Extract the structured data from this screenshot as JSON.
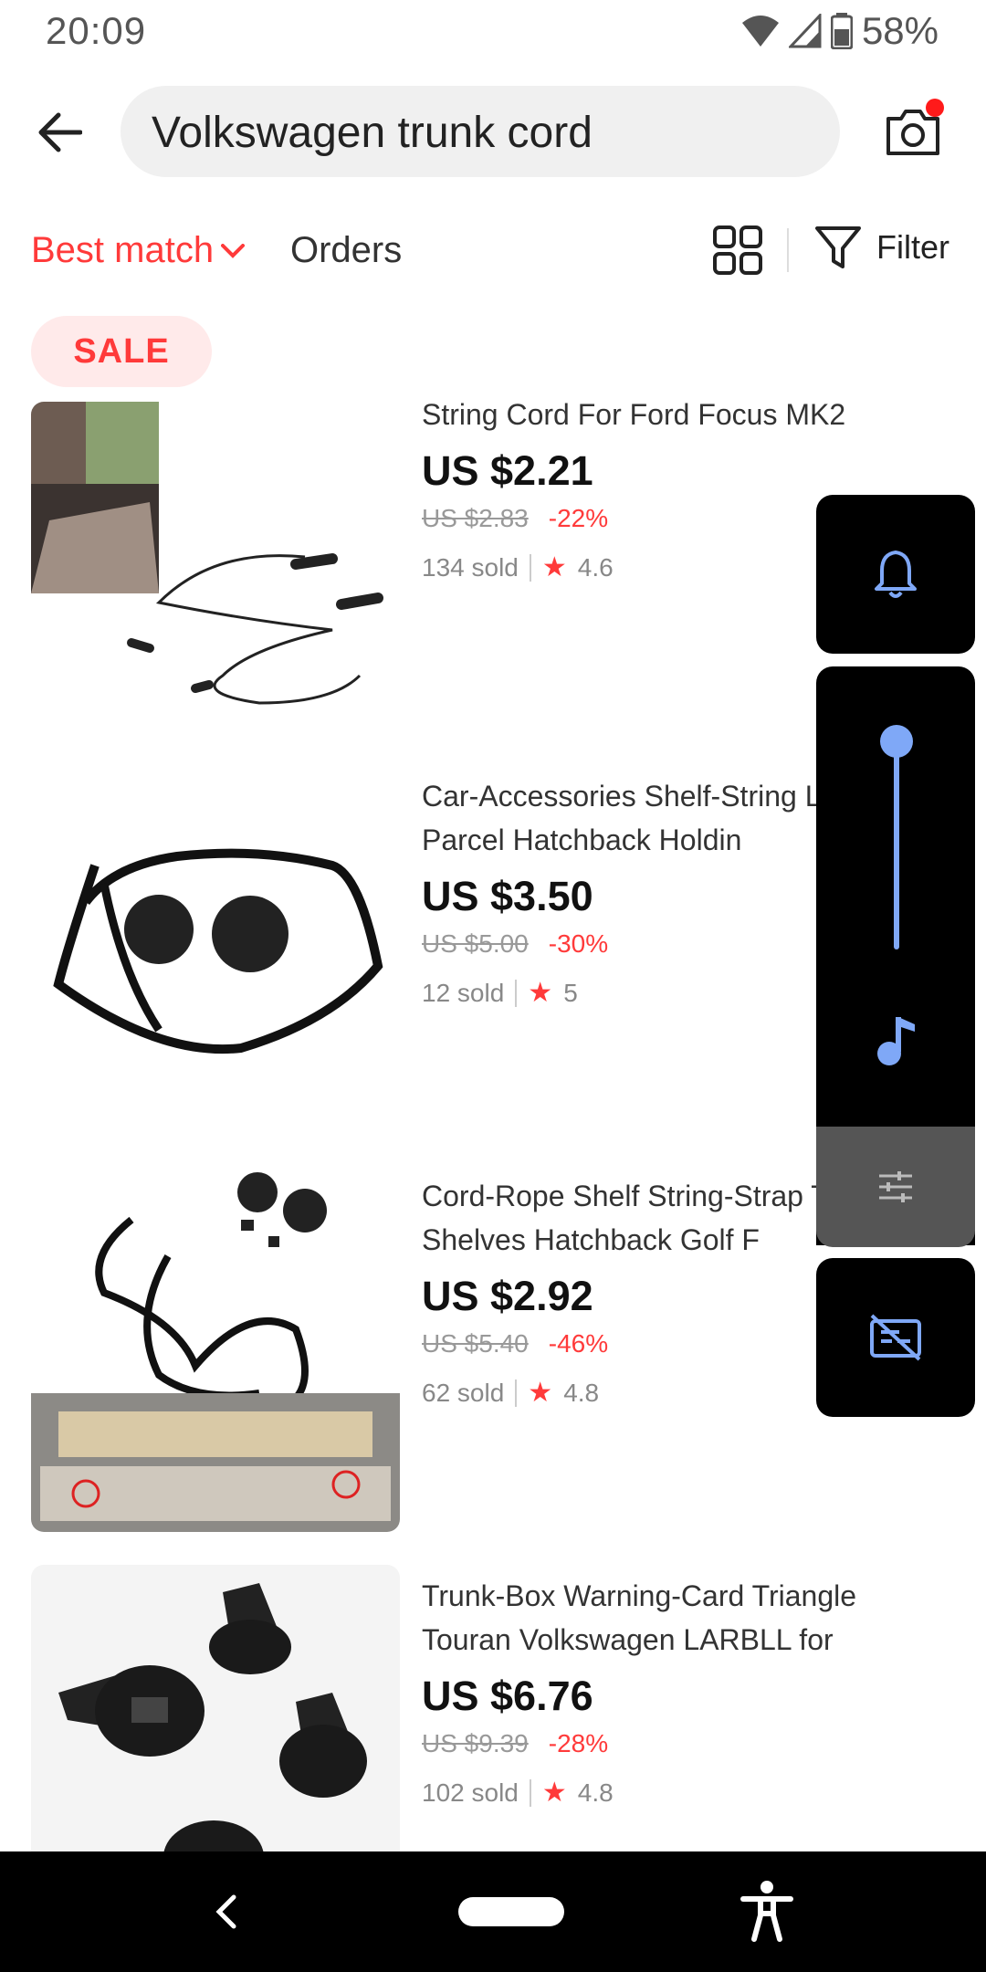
{
  "status_bar": {
    "time": "20:09",
    "battery": "58%"
  },
  "search": {
    "query": "Volkswagen trunk cord"
  },
  "sort": {
    "best_match": "Best match",
    "orders": "Orders",
    "filter": "Filter"
  },
  "chips": {
    "sale": "SALE"
  },
  "products": [
    {
      "title": "String Cord For Ford Focus MK2 2004-...",
      "price": "US $2.21",
      "original_price": "US $2.83",
      "discount": "-22%",
      "sold": "134 sold",
      "rating": "4.6"
    },
    {
      "title": "Car-Accessories Shelf-String L Trunk Parcel Hatchback Holdin",
      "price": "US $3.50",
      "original_price": "US $5.00",
      "discount": "-30%",
      "sold": "12 sold",
      "rating": "5"
    },
    {
      "title": "Cord-Rope Shelf String-Strap T Rear-Shelves Hatchback Golf F",
      "price": "US $2.92",
      "original_price": "US $5.40",
      "discount": "-46%",
      "sold": "62 sold",
      "rating": "4.8"
    },
    {
      "title": "Trunk-Box Warning-Card Triangle Touran Volkswagen LARBLL for Vw/Touran/1t...",
      "price": "US $6.76",
      "original_price": "US $9.39",
      "discount": "-28%",
      "sold": "102 sold",
      "rating": "4.8"
    }
  ],
  "volume_panel": {
    "level": 1.0
  },
  "colors": {
    "accent": "#ff3a3a",
    "volume_blue": "#7fa8f7"
  }
}
